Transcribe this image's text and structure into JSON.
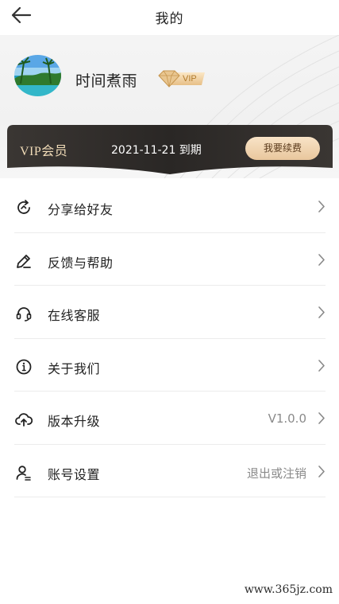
{
  "header": {
    "back_icon": "arrow-left-icon",
    "title": "我的"
  },
  "profile": {
    "avatar": "beach-landscape-avatar",
    "username": "时间煮雨",
    "vip_badge": "VIP"
  },
  "vip_card": {
    "label": "VIP会员",
    "expiry": "2021-11-21 到期",
    "renew_button": "我要续费"
  },
  "menu": {
    "items": [
      {
        "icon": "share-icon",
        "label": "分享给好友",
        "value": ""
      },
      {
        "icon": "pencil-icon",
        "label": "反馈与帮助",
        "value": ""
      },
      {
        "icon": "headset-icon",
        "label": "在线客服",
        "value": ""
      },
      {
        "icon": "info-icon",
        "label": "关于我们",
        "value": ""
      },
      {
        "icon": "cloud-upload-icon",
        "label": "版本升级",
        "value": "V1.0.0"
      },
      {
        "icon": "user-settings-icon",
        "label": "账号设置",
        "value": "退出或注销"
      }
    ]
  },
  "watermark": "www.365jz.com",
  "colors": {
    "vip_card_dark": "#2f2c2a",
    "vip_gold_text": "#f1dcb8",
    "renew_button_gold": "#ecc99f",
    "divider": "#ececec"
  }
}
